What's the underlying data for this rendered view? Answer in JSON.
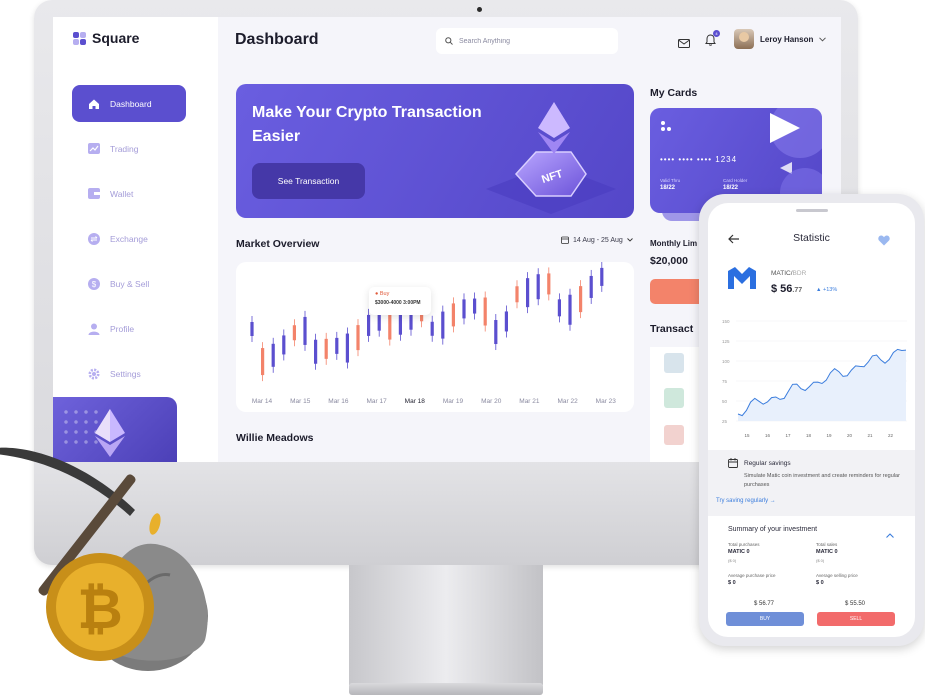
{
  "app": {
    "name": "Square"
  },
  "nav": {
    "items": [
      {
        "label": "Dashboard",
        "icon": "home-icon",
        "active": true
      },
      {
        "label": "Trading",
        "icon": "chart-icon"
      },
      {
        "label": "Wallet",
        "icon": "wallet-icon"
      },
      {
        "label": "Exchange",
        "icon": "exchange-icon"
      },
      {
        "label": "Buy & Sell",
        "icon": "dollar-icon"
      },
      {
        "label": "Profile",
        "icon": "user-icon"
      },
      {
        "label": "Settings",
        "icon": "gear-icon"
      }
    ]
  },
  "header": {
    "title": "Dashboard",
    "search_placeholder": "Search Anything",
    "notification_count": "4",
    "user_name": "Leroy Hanson"
  },
  "hero": {
    "title": "Make Your Crypto Transaction Easier",
    "button": "See Transaction",
    "art_label": "NFT"
  },
  "market": {
    "title": "Market Overview",
    "date_range": "14 Aug - 25 Aug",
    "tooltip": {
      "label": "Buy",
      "range": "$3000-4000",
      "time": "3:00PM"
    },
    "x_labels": [
      "Mar 14",
      "Mar 15",
      "Mar 16",
      "Mar 17",
      "Mar 18",
      "Mar 19",
      "Mar 20",
      "Mar 21",
      "Mar 22",
      "Mar 23"
    ],
    "highlight_label": "Mar 18"
  },
  "cards": {
    "title": "My Cards",
    "number": "•••• •••• •••• 1234",
    "valid_label": "Valid Thru",
    "valid_value": "18/22",
    "holder_label": "Card Holder",
    "holder_value": "18/22"
  },
  "limit": {
    "title": "Monthly Lim",
    "value": "$20,000"
  },
  "transactions": {
    "title": "Transact"
  },
  "section2": {
    "title": "Willie Meadows"
  },
  "phone": {
    "title": "Statistic",
    "pair_main": "MATIC/",
    "pair_quote": "BDR",
    "price": "$ 56",
    "price_cents": ".77",
    "change": "+13%",
    "y_labels": [
      "150",
      "125",
      "100",
      "75",
      "50",
      "25"
    ],
    "x_labels": [
      "15",
      "16",
      "17",
      "18",
      "19",
      "20",
      "21",
      "22"
    ],
    "savings_title": "Regular savings",
    "savings_text": "Simulate Matic coin investment and create reminders for regular purchases",
    "savings_link": "Try saving regularly →",
    "summary_title": "Summary of your investment",
    "total_purchases_label": "Total purchases",
    "total_purchases_value": "MATIC 0",
    "total_purchases_sub": "($ 0)",
    "total_sales_label": "Total sales",
    "total_sales_value": "MATIC 0",
    "total_sales_sub": "($ 0)",
    "avg_purchase_label": "Average purchase price",
    "avg_purchase_value": "$ 0",
    "avg_selling_label": "Average selling price",
    "avg_selling_value": "$ 0",
    "buy_price": "$ 56.77",
    "sell_price": "$ 55.50",
    "buy_button": "BUY",
    "sell_button": "SELL"
  },
  "colors": {
    "accent": "#5b4fcf",
    "up": "#5b4fcf",
    "down": "#f3836a",
    "sell": "#f26b6b",
    "buy": "#6f8fd8"
  }
}
